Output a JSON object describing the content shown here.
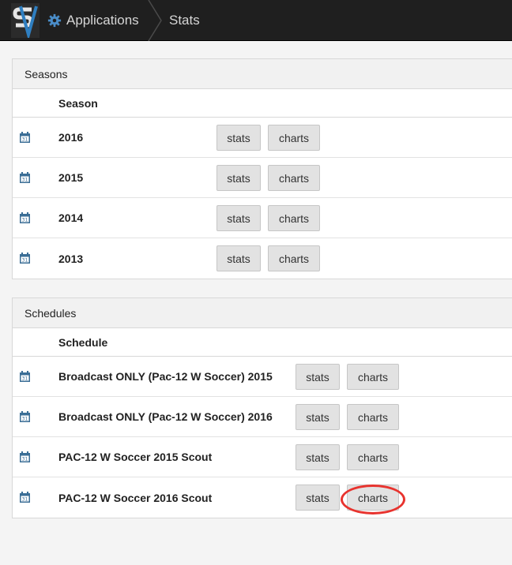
{
  "nav": {
    "breadcrumb_app": "Applications",
    "breadcrumb_current": "Stats",
    "logo_icon": "sv-logo",
    "gear_icon": "gear-icon"
  },
  "seasons": {
    "title": "Seasons",
    "column_header": "Season",
    "stats_label": "stats",
    "charts_label": "charts",
    "rows": [
      "2016",
      "2015",
      "2014",
      "2013"
    ]
  },
  "schedules": {
    "title": "Schedules",
    "column_header": "Schedule",
    "stats_label": "stats",
    "charts_label": "charts",
    "rows": [
      "Broadcast ONLY (Pac-12 W Soccer) 2015",
      "Broadcast ONLY (Pac-12 W Soccer) 2016",
      "PAC-12 W Soccer 2015 Scout",
      "PAC-12 W Soccer 2016 Scout"
    ]
  },
  "colors": {
    "topbar": "#1f1f1f",
    "calendar_icon": "#3b6e96",
    "highlight": "#e8332e"
  }
}
